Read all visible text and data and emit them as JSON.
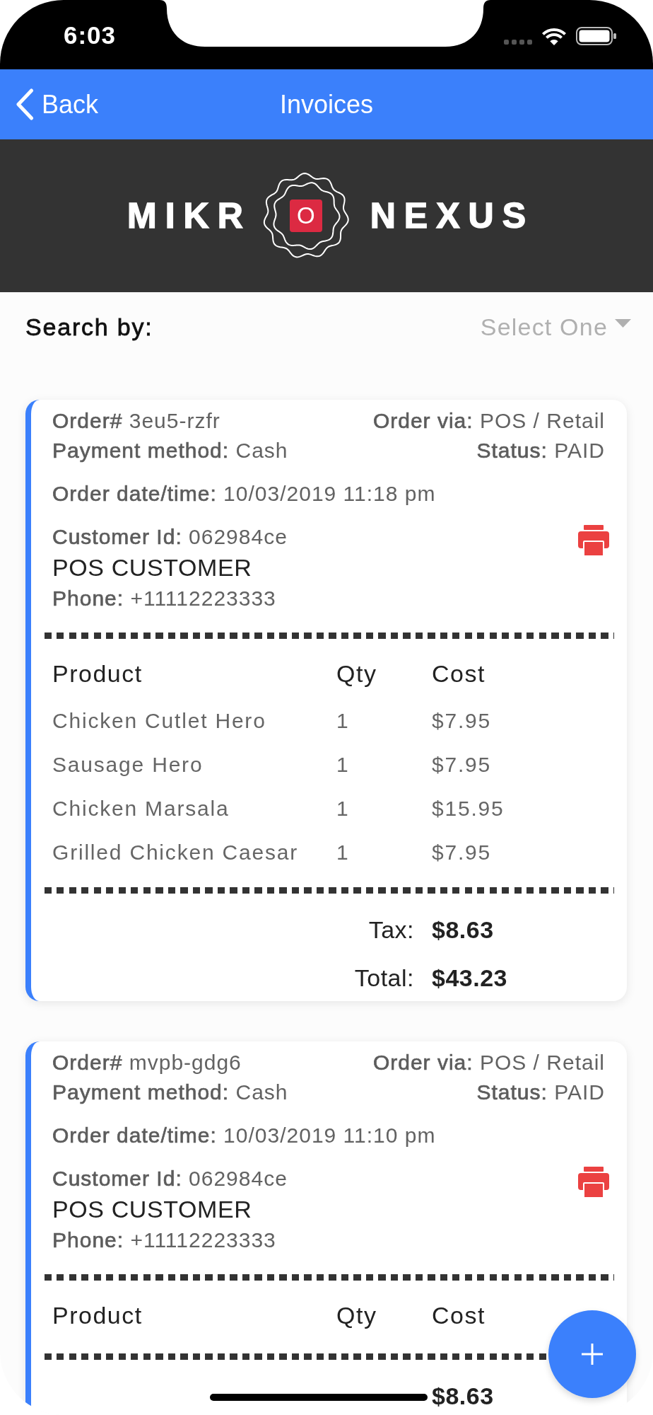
{
  "status_bar": {
    "time": "6:03"
  },
  "nav_bar": {
    "back_label": "Back",
    "title": "Invoices"
  },
  "logo": {
    "text_before": "MIKR",
    "badge_letter": "O",
    "text_after": "NEXUS"
  },
  "search": {
    "label": "Search by:",
    "dropdown": {
      "placeholder": "Select One"
    }
  },
  "invoices": [
    {
      "order_number": "**Order#** 3eu5-rzfr",
      "order_via": "**Order via:** POS / Retail",
      "payment_method": "**Payment method:** Cash",
      "status": "**Status:** PAID",
      "order_datetime": "**Order date/time:** 10/03/2019 11:18 pm",
      "customer_id": "**Customer Id:** 062984ce",
      "customer_name": "POS CUSTOMER",
      "phone": "**Phone:** +11112223333",
      "table": {
        "columns": [
          "Product",
          "Qty",
          "Cost"
        ],
        "rows": [
          [
            "Chicken Cutlet Hero",
            "1",
            "$7.95"
          ],
          [
            "Sausage Hero",
            "1",
            "$7.95"
          ],
          [
            "Chicken Marsala",
            "1",
            "$15.95"
          ],
          [
            "Grilled Chicken Caesar",
            "1",
            "$7.95"
          ]
        ]
      },
      "totals": [
        {
          "label": "Tax:",
          "value": "$8.63"
        },
        {
          "label": "Total:",
          "value": "$43.23"
        }
      ]
    },
    {
      "order_number": "**Order#** mvpb-gdg6",
      "order_via": "**Order via:** POS / Retail",
      "payment_method": "**Payment method:** Cash",
      "status": "**Status:** PAID",
      "order_datetime": "**Order date/time:** 10/03/2019 11:10 pm",
      "customer_id": "**Customer Id:** 062984ce",
      "customer_name": "POS CUSTOMER",
      "phone": "**Phone:** +11112223333",
      "table": {
        "columns": [
          "Product",
          "Qty",
          "Cost"
        ]
      },
      "totals": [
        {
          "value": "$8.63"
        }
      ]
    }
  ]
}
